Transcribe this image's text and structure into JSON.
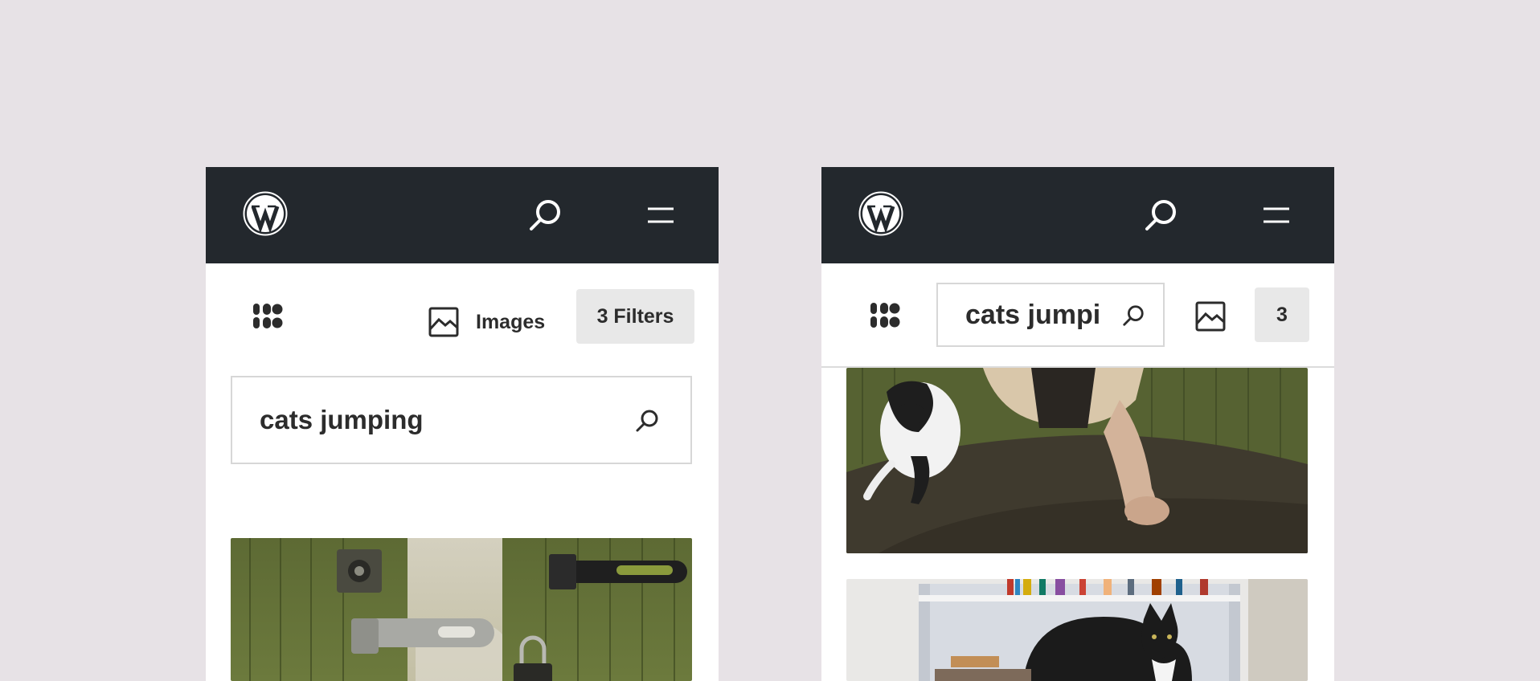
{
  "left_screen": {
    "toolbar": {
      "images_label": "Images",
      "filters_label": "3 Filters"
    },
    "search": {
      "value": "cats jumping"
    },
    "results": [
      {
        "alt": "Padlocks and hasps on a green wooden door"
      }
    ]
  },
  "right_screen": {
    "toolbar": {
      "search_value": "cats jumping",
      "filters_label": "3"
    },
    "results": [
      {
        "alt": "Black and white cat leaping over a table with a hand"
      },
      {
        "alt": "Black cat sitting on a bookshelf"
      }
    ]
  },
  "colors": {
    "background": "#e7e2e6",
    "header": "#23282d",
    "filter_button": "#e8e8e8",
    "text": "#2c2c2c"
  },
  "icons": [
    "wordpress-logo",
    "search-icon",
    "menu-icon",
    "grid-icon",
    "image-icon"
  ]
}
